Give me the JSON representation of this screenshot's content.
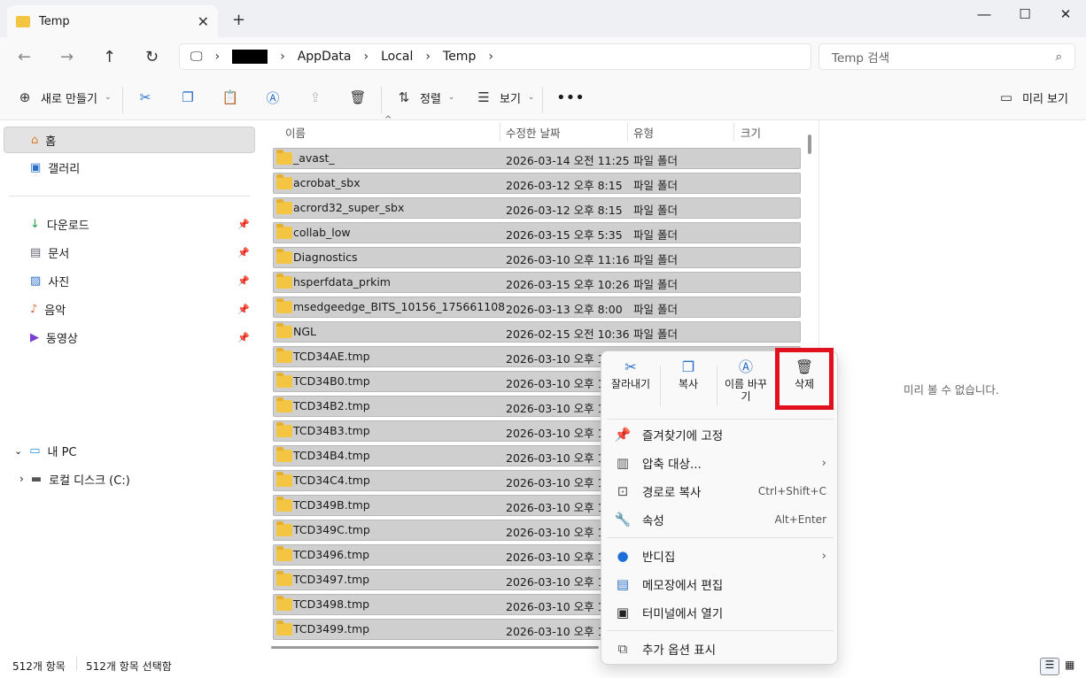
{
  "window": {
    "tab_title": "Temp"
  },
  "address": {
    "segments": [
      "AppData",
      "Local",
      "Temp"
    ]
  },
  "search": {
    "placeholder": "Temp 검색"
  },
  "toolbar": {
    "new_label": "새로 만들기",
    "sort_label": "정렬",
    "view_label": "보기",
    "preview_label": "미리 보기"
  },
  "sidebar": {
    "quick": [
      {
        "label": "홈"
      },
      {
        "label": "갤러리"
      }
    ],
    "pinned": [
      {
        "label": "다운로드"
      },
      {
        "label": "문서"
      },
      {
        "label": "사진"
      },
      {
        "label": "음악"
      },
      {
        "label": "동영상"
      }
    ],
    "pc_label": "내 PC",
    "disk_label": "로컬 디스크 (C:)"
  },
  "columns": {
    "name": "이름",
    "date": "수정한 날짜",
    "type": "유형",
    "size": "크기"
  },
  "files": [
    {
      "name": "_avast_",
      "date": "2026-03-14 오전 11:25",
      "type": "파일 폴더"
    },
    {
      "name": "acrobat_sbx",
      "date": "2026-03-12 오후 8:15",
      "type": "파일 폴더"
    },
    {
      "name": "acrord32_super_sbx",
      "date": "2026-03-12 오후 8:15",
      "type": "파일 폴더"
    },
    {
      "name": "collab_low",
      "date": "2026-03-15 오후 5:35",
      "type": "파일 폴더"
    },
    {
      "name": "Diagnostics",
      "date": "2026-03-10 오후 11:16",
      "type": "파일 폴더"
    },
    {
      "name": "hsperfdata_prkim",
      "date": "2026-03-15 오후 10:26",
      "type": "파일 폴더"
    },
    {
      "name": "msedgeedge_BITS_10156_175661108",
      "date": "2026-03-13 오후 8:00",
      "type": "파일 폴더"
    },
    {
      "name": "NGL",
      "date": "2026-02-15 오전 10:36",
      "type": "파일 폴더"
    },
    {
      "name": "TCD34AE.tmp",
      "date": "2026-03-10 오후 1",
      "type": ""
    },
    {
      "name": "TCD34B0.tmp",
      "date": "2026-03-10 오후 1",
      "type": ""
    },
    {
      "name": "TCD34B2.tmp",
      "date": "2026-03-10 오후 1",
      "type": ""
    },
    {
      "name": "TCD34B3.tmp",
      "date": "2026-03-10 오후 1",
      "type": ""
    },
    {
      "name": "TCD34B4.tmp",
      "date": "2026-03-10 오후 1",
      "type": ""
    },
    {
      "name": "TCD34C4.tmp",
      "date": "2026-03-10 오후 1",
      "type": ""
    },
    {
      "name": "TCD349B.tmp",
      "date": "2026-03-10 오후 1",
      "type": ""
    },
    {
      "name": "TCD349C.tmp",
      "date": "2026-03-10 오후 1",
      "type": ""
    },
    {
      "name": "TCD3496.tmp",
      "date": "2026-03-10 오후 1",
      "type": ""
    },
    {
      "name": "TCD3497.tmp",
      "date": "2026-03-10 오후 1",
      "type": ""
    },
    {
      "name": "TCD3498.tmp",
      "date": "2026-03-10 오후 1",
      "type": ""
    },
    {
      "name": "TCD3499.tmp",
      "date": "2026-03-10 오후 1",
      "type": ""
    }
  ],
  "preview": {
    "empty_text": "미리 볼 수 없습니다."
  },
  "status": {
    "count": "512개 항목",
    "selected": "512개 항목 선택함"
  },
  "context_menu": {
    "quick": {
      "cut": "잘라내기",
      "copy": "복사",
      "rename": "이름 바꾸기",
      "delete": "삭제"
    },
    "items": {
      "pin": "즐겨찾기에 고정",
      "compress": "압축 대상...",
      "copy_path": "경로로 복사",
      "copy_path_shortcut": "Ctrl+Shift+C",
      "properties": "속성",
      "properties_shortcut": "Alt+Enter",
      "bandizip": "반디집",
      "notepad": "메모장에서 편집",
      "terminal": "터미널에서 열기",
      "more": "추가 옵션 표시"
    }
  }
}
